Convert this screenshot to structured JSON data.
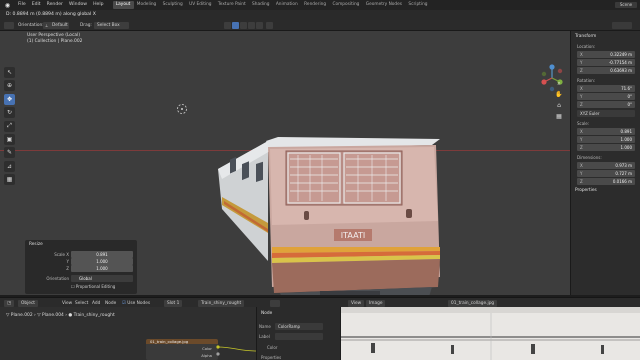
{
  "topbar": {
    "menus": [
      "File",
      "Edit",
      "Render",
      "Window",
      "Help"
    ],
    "workspaces": [
      "Layout",
      "Modeling",
      "Sculpting",
      "UV Editing",
      "Texture Paint",
      "Shading",
      "Animation",
      "Rendering",
      "Compositing",
      "Geometry Nodes",
      "Scripting"
    ],
    "active_workspace": "Layout",
    "scene": "Scene"
  },
  "status": {
    "text": "D: 0.8894 m (0.8894 m) along global X"
  },
  "header3d": {
    "orientation_label": "Orientation:",
    "orientation_value": "Default",
    "drag_label": "Drag:",
    "drag_value": "Select Box"
  },
  "viewport": {
    "line1": "User Perspective (Local)",
    "line2": "(1) Collection | Plane.002"
  },
  "tools": [
    "cursor",
    "select",
    "move",
    "rotate",
    "scale",
    "transform",
    "annotate",
    "measure",
    "add-cube"
  ],
  "npanel": {
    "transform_title": "Transform",
    "location_label": "Location:",
    "location": [
      {
        "axis": "X",
        "value": "0.32249 m"
      },
      {
        "axis": "Y",
        "value": "-0.77154 m"
      },
      {
        "axis": "Z",
        "value": "0.63693 m"
      }
    ],
    "rotation_label": "Rotation:",
    "rotation": [
      {
        "axis": "X",
        "value": "71.6°"
      },
      {
        "axis": "Y",
        "value": "0°"
      },
      {
        "axis": "Z",
        "value": "0°"
      }
    ],
    "rotation_mode": "XYZ Euler",
    "scale_label": "Scale:",
    "scale": [
      {
        "axis": "X",
        "value": "0.891"
      },
      {
        "axis": "Y",
        "value": "1.000"
      },
      {
        "axis": "Z",
        "value": "1.000"
      }
    ],
    "dimensions_label": "Dimensions:",
    "dimensions": [
      {
        "axis": "X",
        "value": "0.973 m"
      },
      {
        "axis": "Y",
        "value": "0.727 m"
      },
      {
        "axis": "Z",
        "value": "0.0166 m"
      }
    ],
    "properties_title": "Properties"
  },
  "resize_panel": {
    "title": "Resize",
    "scale_x_label": "Scale X",
    "scale_x": "0.891",
    "y_label": "Y",
    "y": "1.000",
    "z_label": "Z",
    "z": "1.000",
    "orientation_label": "Orientation",
    "orientation": "Global",
    "proportional": "Proportional Editing"
  },
  "bottom_header": {
    "object": "Object",
    "view": "View",
    "select": "Select",
    "add": "Add",
    "node": "Node",
    "use_nodes": "Use Nodes",
    "slot": "Slot 1",
    "material": "Train_shiny_rought",
    "image_name": "01_train_collage.jpg"
  },
  "node_editor": {
    "breadcrumb": [
      "Plane.002",
      "Plane.004",
      "Train_shiny_rought"
    ],
    "image_node_title": "01_train_collage.jpg",
    "color_socket": "Color",
    "alpha_socket": "Alpha",
    "attributes_label": "Properties"
  },
  "node_panel": {
    "title": "Node",
    "name_label": "Name",
    "name_value": "ColorRamp",
    "label_label": "Label",
    "color_label": "Color"
  }
}
